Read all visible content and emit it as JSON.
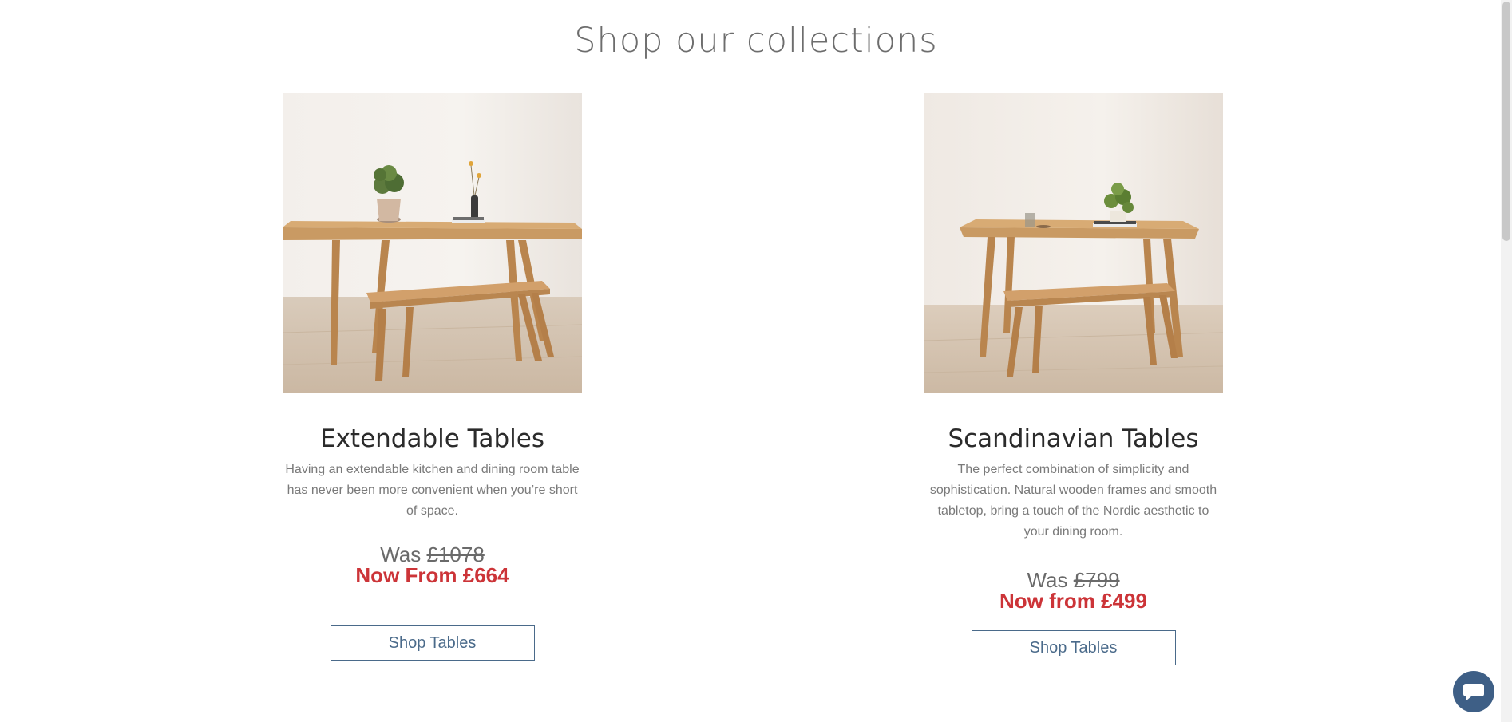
{
  "section": {
    "title": "Shop our collections"
  },
  "collections": [
    {
      "title": "Extendable Tables",
      "description": "Having an extendable kitchen and dining room table has never been more convenient when you’re short of space.",
      "was_label": "Was",
      "old_price": "£1078",
      "now_price": "Now From £664",
      "button_label": "Shop Tables",
      "image_icon": "extendable-table-photo"
    },
    {
      "title": "Scandinavian Tables",
      "description": "The perfect combination of simplicity and sophistication. Natural wooden frames and smooth tabletop, bring a touch of the Nordic aesthetic to your dining room.",
      "was_label": "Was",
      "old_price": "£799",
      "now_price": "Now from £499",
      "button_label": "Shop Tables",
      "image_icon": "scandinavian-table-photo"
    }
  ],
  "colors": {
    "accent_red": "#cc3438",
    "button_blue": "#4a6a8a",
    "chat_blue": "#3e5f86"
  },
  "chat": {
    "icon": "chat-icon"
  }
}
